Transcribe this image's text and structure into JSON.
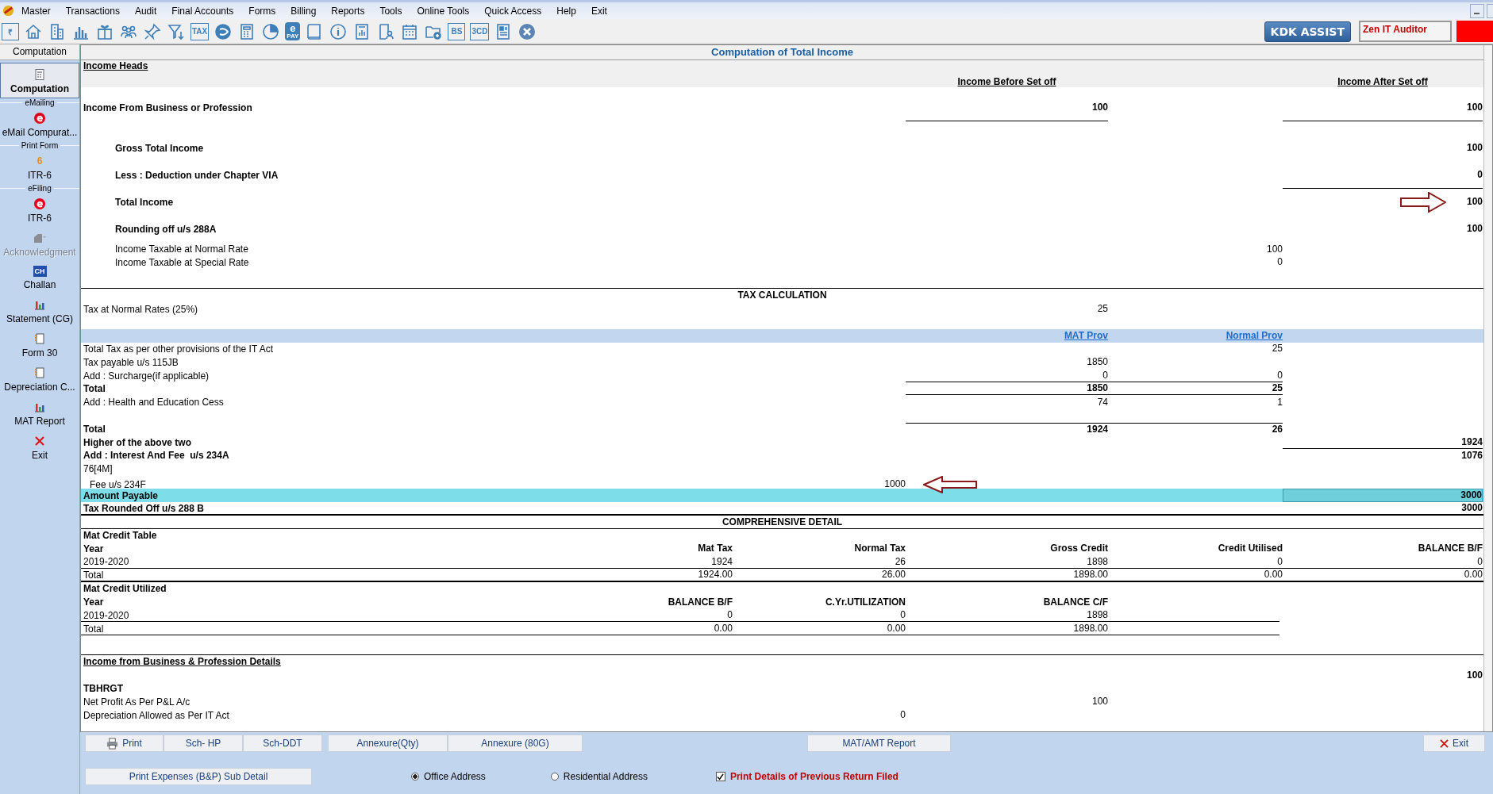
{
  "menu": [
    "Master",
    "Transactions",
    "Audit",
    "Final Accounts",
    "Forms",
    "Billing",
    "Reports",
    "Tools",
    "Online Tools",
    "Quick Access",
    "Help",
    "Exit"
  ],
  "toolbar": [
    {
      "kind": "text",
      "texts": [
        "₹"
      ]
    },
    {
      "kind": "icon"
    },
    {
      "kind": "icon"
    },
    {
      "kind": "icon"
    },
    {
      "kind": "icon"
    },
    {
      "kind": "icon"
    },
    {
      "kind": "icon"
    },
    {
      "kind": "icon"
    },
    {
      "kind": "text",
      "texts": [
        "TAX"
      ]
    },
    {
      "kind": "icon"
    },
    {
      "kind": "icon"
    },
    {
      "kind": "icon"
    },
    {
      "kind": "pay",
      "texts": [
        "e",
        "PAY"
      ]
    },
    {
      "kind": "icon"
    },
    {
      "kind": "icon"
    },
    {
      "kind": "icon"
    },
    {
      "kind": "icon"
    },
    {
      "kind": "icon"
    },
    {
      "kind": "icon"
    },
    {
      "kind": "text",
      "texts": [
        "BS"
      ]
    },
    {
      "kind": "text",
      "texts": [
        "3CD"
      ]
    },
    {
      "kind": "icon"
    },
    {
      "kind": "icon"
    }
  ],
  "assist_button": "KDK ASSIST",
  "product_field": "Zen IT Auditor",
  "sidebar": {
    "tab": "Computation",
    "items": [
      {
        "kind": "item",
        "label": "Computation",
        "selected": true,
        "disabled": false
      },
      {
        "kind": "group",
        "label": "eMailing"
      },
      {
        "kind": "item",
        "label": "eMail Compurat...",
        "selected": false,
        "disabled": false
      },
      {
        "kind": "group",
        "label": "Print Form"
      },
      {
        "kind": "item",
        "label": "ITR-6",
        "icon_text": "6",
        "selected": false,
        "disabled": false
      },
      {
        "kind": "group",
        "label": "eFiling"
      },
      {
        "kind": "item",
        "label": "ITR-6",
        "selected": false,
        "disabled": false
      },
      {
        "kind": "item",
        "label": "Acknowledgment",
        "selected": false,
        "disabled": true
      },
      {
        "kind": "item",
        "label": "Challan",
        "icon_text": "CH",
        "selected": false,
        "disabled": false
      },
      {
        "kind": "item",
        "label": "Statement (CG)",
        "selected": false,
        "disabled": false
      },
      {
        "kind": "item",
        "label": "Form 30",
        "selected": false,
        "disabled": false
      },
      {
        "kind": "item",
        "label": "Depreciation C...",
        "selected": false,
        "disabled": false
      },
      {
        "kind": "item",
        "label": "MAT Report",
        "selected": false,
        "disabled": false
      },
      {
        "kind": "item",
        "label": "Exit",
        "selected": false,
        "disabled": false
      }
    ]
  },
  "report": {
    "title": "Computation of Total Income",
    "header": {
      "label": "Income Heads",
      "columns": [
        null,
        null,
        "Income Before Set off",
        null,
        "Income After Set off"
      ]
    },
    "rows": [
      {
        "kind": "major",
        "label": "Income From Business or Profession",
        "indented": false,
        "cells": [
          null,
          null,
          {
            "text": "100",
            "rule_below": true
          },
          null,
          {
            "text": "100",
            "rule_below": true
          }
        ]
      },
      {
        "kind": "spacer"
      },
      {
        "kind": "major",
        "label": "Gross Total Income",
        "indented": true,
        "cells": [
          null,
          null,
          null,
          null,
          "100"
        ]
      },
      {
        "kind": "major",
        "label": "Less : Deduction under Chapter VIA",
        "indented": true,
        "cells": [
          null,
          null,
          null,
          null,
          {
            "text": "0",
            "rule_below": true
          }
        ]
      },
      {
        "kind": "major",
        "label": "Total Income",
        "indented": true,
        "arrow_right": true,
        "cells": [
          null,
          null,
          null,
          null,
          "100"
        ]
      },
      {
        "kind": "major",
        "label": "Rounding off u/s 288A",
        "indented": true,
        "cells": [
          null,
          null,
          null,
          null,
          "100"
        ]
      },
      {
        "kind": "row",
        "label": "Income Taxable at Normal Rate",
        "indented": true,
        "cells": [
          null,
          null,
          null,
          "100",
          null
        ]
      },
      {
        "kind": "row",
        "label": "Income Taxable at Special Rate",
        "indented": true,
        "cells": [
          null,
          null,
          null,
          "0",
          null
        ]
      },
      {
        "kind": "spacer",
        "thin_rule": true
      },
      {
        "kind": "section",
        "label": "TAX CALCULATION"
      },
      {
        "kind": "row",
        "label": "Tax at Normal Rates (25%)",
        "cells": [
          null,
          null,
          "25",
          null,
          null
        ]
      },
      {
        "kind": "spacer"
      },
      {
        "kind": "band",
        "cells": [
          null,
          null,
          "MAT Prov",
          "Normal Prov",
          null
        ]
      },
      {
        "kind": "row",
        "label": "Total Tax as per other provisions of the IT Act",
        "cells": [
          null,
          null,
          null,
          "25",
          null
        ]
      },
      {
        "kind": "row",
        "label": "Tax payable u/s 115JB",
        "cells": [
          null,
          null,
          "1850",
          null,
          null
        ]
      },
      {
        "kind": "row",
        "label": "Add : Surcharge(if applicable)",
        "cells": [
          null,
          null,
          {
            "text": "0",
            "rule_below": true
          },
          {
            "text": "0",
            "rule_below": true
          },
          null
        ]
      },
      {
        "kind": "row",
        "label": "Total",
        "bold": true,
        "cells": [
          null,
          null,
          {
            "text": "1850",
            "rule_below": true
          },
          {
            "text": "25",
            "rule_below": true
          },
          null
        ]
      },
      {
        "kind": "row",
        "label": "Add : Health and Education Cess",
        "cells": [
          null,
          null,
          "74",
          "1",
          null
        ]
      },
      {
        "kind": "spacer"
      },
      {
        "kind": "row",
        "label": "Total",
        "bold": true,
        "cells": [
          null,
          null,
          {
            "text": "1924",
            "rule_above": true
          },
          {
            "text": "26",
            "rule_above": true
          },
          null
        ]
      },
      {
        "kind": "row",
        "label": "Higher of the above two",
        "bold": true,
        "cells": [
          null,
          null,
          null,
          null,
          {
            "text": "1924",
            "rule_below": true
          }
        ]
      },
      {
        "kind": "row",
        "label": "Add : Interest And Fee  u/s 234A",
        "bold": true,
        "cells": [
          null,
          null,
          null,
          null,
          "1076"
        ]
      },
      {
        "kind": "row",
        "label": "76[4M]",
        "cells": [
          null,
          null,
          null,
          null,
          null
        ]
      },
      {
        "kind": "row",
        "label": "Fee u/s 234F",
        "nudged": true,
        "arrow_left": true,
        "cells": [
          null,
          "1000",
          null,
          null,
          null
        ]
      },
      {
        "kind": "highlight",
        "label": "Amount Payable",
        "bold": true,
        "cells": [
          null,
          null,
          null,
          null,
          {
            "text": "3000",
            "boxed": true
          }
        ]
      },
      {
        "kind": "row",
        "label": "Tax Rounded Off u/s 288 B",
        "bold": true,
        "thick_rule": true,
        "cells": [
          null,
          null,
          null,
          null,
          "3000"
        ]
      },
      {
        "kind": "section",
        "label": "COMPREHENSIVE DETAIL",
        "thin_rule": true
      },
      {
        "kind": "row",
        "label": "Mat Credit Table",
        "bold": true,
        "cells": [
          null,
          null,
          null,
          null,
          null
        ]
      },
      {
        "kind": "row",
        "label": "Year",
        "bold": true,
        "cells": [
          "Mat Tax",
          "Normal Tax",
          "Gross Credit",
          "Credit Utilised",
          "BALANCE B/F"
        ]
      },
      {
        "kind": "row",
        "label": "2019-2020",
        "thin_rule": true,
        "cells": [
          "1924",
          "26",
          "1898",
          "0",
          "0"
        ]
      },
      {
        "kind": "row",
        "label": "Total",
        "thick_rule": true,
        "cells": [
          "1924.00",
          "26.00",
          "1898.00",
          "0.00",
          "0.00"
        ]
      },
      {
        "kind": "row",
        "label": "Mat Credit Utilized",
        "bold": true,
        "cells": [
          null,
          null,
          null,
          null,
          null
        ]
      },
      {
        "kind": "row",
        "label": "Year",
        "bold": true,
        "cells": [
          "BALANCE B/F",
          "C.Yr.UTILIZATION",
          "BALANCE C/F",
          null,
          null
        ]
      },
      {
        "kind": "row",
        "label": "2019-2020",
        "partial_rule": true,
        "cells": [
          "0",
          "0",
          "1898",
          null,
          null
        ]
      },
      {
        "kind": "row",
        "label": "Total",
        "partial_rule": true,
        "cells": [
          "0.00",
          "0.00",
          "1898.00",
          null,
          null
        ]
      },
      {
        "kind": "spacer",
        "thin_rule": true
      },
      {
        "kind": "title",
        "label": "Income from Business & Profession Details"
      },
      {
        "kind": "row",
        "bold": true,
        "cells": [
          null,
          null,
          null,
          null,
          "100"
        ]
      },
      {
        "kind": "row",
        "label": "TBHRGT",
        "bold": true,
        "cells": [
          null,
          null,
          null,
          null,
          null
        ]
      },
      {
        "kind": "row",
        "label": "Net Profit As Per P&L A/c",
        "cells": [
          null,
          null,
          "100",
          null,
          null
        ]
      },
      {
        "kind": "row",
        "label": "Depreciation Allowed as Per IT Act",
        "cells": [
          null,
          "0",
          null,
          null,
          null
        ]
      }
    ]
  },
  "bottom_buttons": [
    "Print",
    "Sch- HP",
    "Sch-DDT",
    "Annexure(Qty)",
    "Annexure (80G)",
    "MAT/AMT Report",
    "Exit"
  ],
  "expenses_button": "Print Expenses (B&P) Sub Detail",
  "address_options": [
    {
      "label": "Office Address",
      "selected": true
    },
    {
      "label": "Residential Address",
      "selected": false
    }
  ],
  "print_previous": {
    "label": "Print Details of Previous Return Filed",
    "checked": true
  }
}
